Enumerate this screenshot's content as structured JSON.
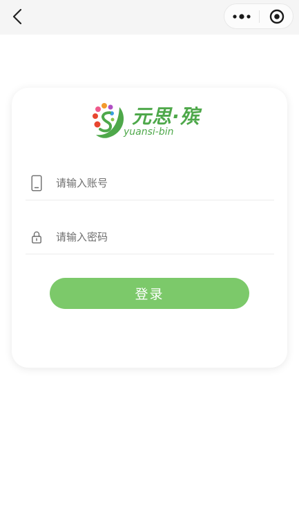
{
  "nav": {
    "back_icon": "chevron-left-icon",
    "more_icon": "more-dots-icon",
    "close_icon": "target-circle-icon"
  },
  "logo": {
    "name_cn": "元思·殡",
    "name_en": "yuansi-bin",
    "brand_color": "#4ea84a"
  },
  "form": {
    "account_placeholder": "请输入账号",
    "account_value": "",
    "account_icon": "phone-icon",
    "password_placeholder": "请输入密码",
    "password_value": "",
    "password_icon": "lock-icon",
    "login_label": "登录",
    "button_color": "#7cc96a"
  }
}
